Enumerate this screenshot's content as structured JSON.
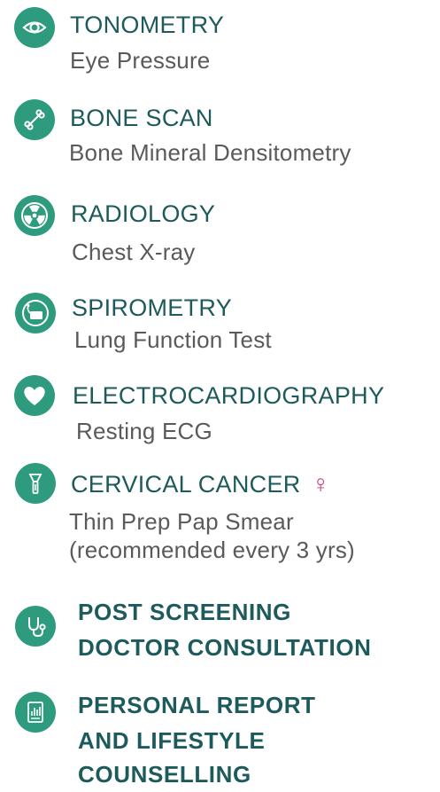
{
  "colors": {
    "icon_bg": "#2e9b7e",
    "title": "#1d5a5c",
    "subtitle": "#5a5a5a",
    "female_symbol": "#c83d80"
  },
  "items": [
    {
      "icon": "eye-icon",
      "title": "TONOMETRY",
      "subtitle": "Eye Pressure"
    },
    {
      "icon": "bone-icon",
      "title": "BONE SCAN",
      "subtitle": "Bone Mineral Densitometry"
    },
    {
      "icon": "radiation-icon",
      "title": "RADIOLOGY",
      "subtitle": "Chest X-ray"
    },
    {
      "icon": "spirometer-icon",
      "title": "SPIROMETRY",
      "subtitle": "Lung Function Test"
    },
    {
      "icon": "heart-icon",
      "title": "ELECTROCARDIOGRAPHY",
      "subtitle": "Resting ECG"
    },
    {
      "icon": "speculum-icon",
      "title": "CERVICAL CANCER",
      "female_symbol": "♀",
      "subtitle_lines": [
        "Thin Prep Pap Smear",
        "(recommended every 3 yrs)"
      ]
    }
  ],
  "bold_items": [
    {
      "icon": "stethoscope-icon",
      "lines": [
        "POST SCREENING",
        "DOCTOR CONSULTATION"
      ]
    },
    {
      "icon": "report-icon",
      "lines": [
        "PERSONAL REPORT",
        "AND LIFESTYLE",
        "COUNSELLING"
      ]
    }
  ]
}
